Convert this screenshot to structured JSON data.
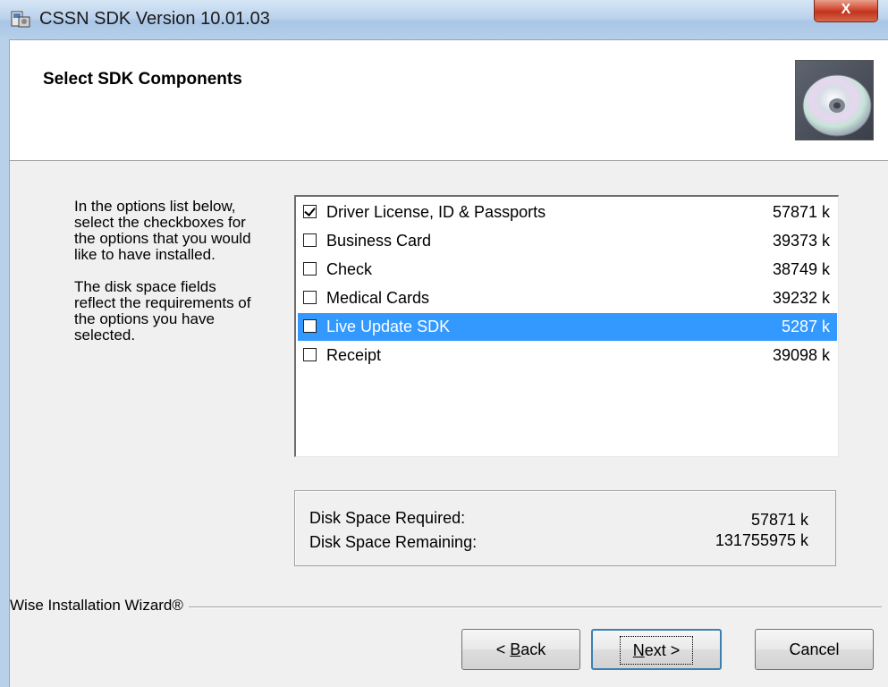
{
  "window": {
    "title": "CSSN SDK Version 10.01.03",
    "close_label": "X",
    "app_icon": "installer-icon",
    "close_color": "#c8381f"
  },
  "header": {
    "title": "Select SDK Components",
    "image_icon": "cd-disc-icon"
  },
  "description": {
    "paragraph1": "In the options list below, select the checkboxes for the options that you would like to have installed.",
    "paragraph2": "The disk space fields reflect the requirements of the options you have selected."
  },
  "components": [
    {
      "label": "Driver License, ID & Passports",
      "size": "57871 k",
      "checked": true,
      "selected": false
    },
    {
      "label": "Business Card",
      "size": "39373 k",
      "checked": false,
      "selected": false
    },
    {
      "label": "Check",
      "size": "38749 k",
      "checked": false,
      "selected": false
    },
    {
      "label": "Medical Cards",
      "size": "39232 k",
      "checked": false,
      "selected": false
    },
    {
      "label": "Live Update SDK",
      "size": "5287 k",
      "checked": false,
      "selected": true
    },
    {
      "label": "Receipt",
      "size": "39098 k",
      "checked": false,
      "selected": false
    }
  ],
  "disk_space": {
    "required_label": "Disk Space Required:",
    "required_value": "57871 k",
    "remaining_label": "Disk Space Remaining:",
    "remaining_value": "131755975 k"
  },
  "footer": {
    "brand": "Wise Installation Wizard®"
  },
  "buttons": {
    "back_prefix": "< ",
    "back_mnemonic": "B",
    "back_rest": "ack",
    "next_mnemonic": "N",
    "next_rest": "ext >",
    "cancel": "Cancel"
  },
  "colors": {
    "selection": "#3399ff",
    "default_button_border": "#3c7fb1"
  }
}
